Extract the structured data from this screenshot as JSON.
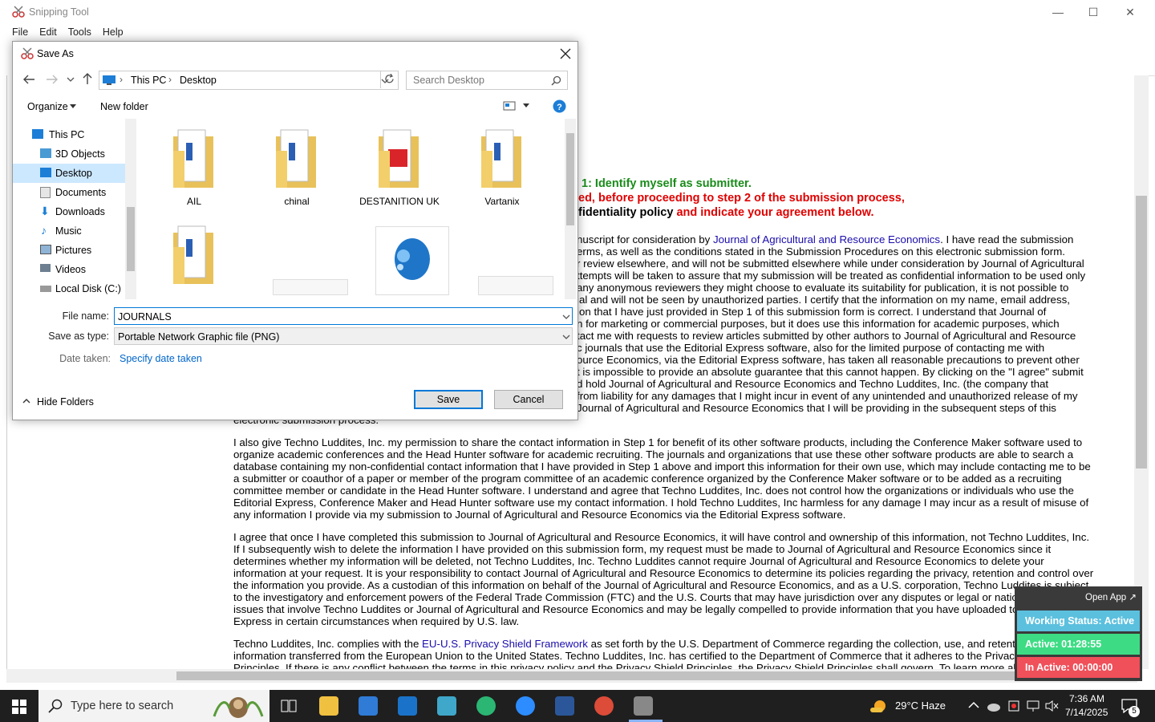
{
  "snip": {
    "title": "Snipping Tool",
    "menu": [
      "File",
      "Edit",
      "Tools",
      "Help"
    ],
    "controls": {
      "minimize": "—",
      "maximize": "☐",
      "close": "✕"
    }
  },
  "doc": {
    "step_heading": "1: Identify myself as submitter.",
    "warning_line1": "ed, before proceeding to step 2 of the submission process,",
    "warning_line2a": "fidentiality policy",
    "warning_line2b": " and indicate your agreement below.",
    "para1": [
      {
        "pre": "nuscript for consideration by ",
        "link": "Journal of Agricultural and Resource Economics",
        "post": ". I have read the submission"
      },
      {
        "text": "erms, as well as the conditions stated in the Submission Procedures on this electronic submission form."
      },
      {
        "text": "r review elsewhere, and will not be submitted elsewhere while under consideration by Journal of Agricultural"
      },
      {
        "text": "ttempts will be taken to assure that my submission will be treated as confidential information to be used only"
      },
      {
        "text": "any anonymous reviewers they might choose to evaluate its suitability for publication, it is not possible to"
      },
      {
        "text": "ial and will not be seen by unauthorized parties. I certify that the information on my name, email address,"
      },
      {
        "text": "ion that I have just provided in Step 1 of this submission form is correct. I understand that Journal of"
      },
      {
        "text": "n for marketing or commercial purposes, but it does use this information for academic purposes, which"
      },
      {
        "text": "tact me with requests to review articles submitted by other authors to Journal of Agricultural and Resource"
      },
      {
        "text": "c journals that use the Editorial Express software, also for the limited purpose of contacting me with"
      },
      {
        "text": "ource Economics, via the Editorial Express software, has taken all reasonable precautions to prevent other"
      },
      {
        "text": "t is impossible to provide an absolute guarantee that this cannot happen. By clicking on the \"I agree\" submit"
      },
      {
        "text": "d hold Journal of Agricultural and Resource Economics and Techno Luddites, Inc. (the company that"
      },
      {
        "text": "from liability for any damages that I might incur in event of any unintended and unauthorized release of my"
      },
      {
        "text": "Journal of Agricultural and Resource Economics that I will be providing in the subsequent steps of this"
      },
      {
        "text": "electronic submission process."
      }
    ],
    "para2": [
      "I also give Techno Luddites, Inc. my permission to share the contact information in Step 1 for benefit of its other software products, including the Conference Maker software used to",
      "organize academic conferences and the Head Hunter software for academic recruiting. The journals and organizations that use these other software products are able to search a",
      "database containing my non-confidential contact information that I have provided in Step 1 above and import this information for their own use, which may include contacting me to be",
      "a submitter or coauthor of a paper or member of the program committee of an academic conference organized by the Conference Maker software or to be added as a recruiting",
      "committee member or candidate in the Head Hunter software. I understand and agree that Techno Luddites, Inc. does not control how the organizations or individuals who use the",
      "Editorial Express, Conference Maker and Head Hunter software use my contact information. I hold Techno Luddites, Inc harmless for any damage I may incur as a result of misuse of",
      "any information I provide via my submission to Journal of Agricultural and Resource Economics via the Editorial Express software."
    ],
    "para3": [
      "I agree that once I have completed this submission to Journal of Agricultural and Resource Economics, it will have control and ownership of this information, not Techno Luddites, Inc.",
      "If I subsequently wish to delete the information I have provided on this submission form, my request must be made to Journal of Agricultural and Resource Economics since it",
      "determines whether my information will be deleted, not Techno Luddites, Inc. Techno Luddites cannot require Journal of Agricultural and Resource Economics to delete your",
      "information at your request. It is your responsibility to contact Journal of Agricultural and Resource Economics to determine its policies regarding the privacy, retention and control over",
      "the information you provide. As a custodian of this information on behalf of the Journal of Agricultural and Resource Economics, and as a U.S. corporation, Techno Luddites is subject",
      "to the investigatory and enforcement powers of the Federal Trade Commission (FTC) and the U.S. Courts that may have jurisdiction over any disputes or legal or national security",
      "issues that involve Techno Luddites or Journal of Agricultural and Resource Economics and may be legally compelled to provide information that you have uploaded to Editorial",
      "Express in certain circumstances when required by U.S. law."
    ],
    "para4_line1_pre": "Techno Luddites, Inc. complies with the ",
    "para4_line1_link": "EU-U.S. Privacy Shield Framework",
    "para4_line1_post": " as set forth by the U.S. Department of Commerce regarding the collection, use, and retention of",
    "para4_line2": "information transferred from the European Union to the United States. Techno Luddites, Inc. has certified to the Department of Commerce that it adheres to the Privacy Shield",
    "para4_line3": "Principles. If there is any conflict between the terms in this privacy policy and the Privacy Shield Principles, the Privacy Shield Principles shall govern. To learn more about the"
  },
  "dialog": {
    "title": "Save As",
    "path": [
      "This PC",
      "Desktop"
    ],
    "search_placeholder": "Search Desktop",
    "organize": "Organize",
    "new_folder": "New folder",
    "nav": [
      "This PC",
      "3D Objects",
      "Desktop",
      "Documents",
      "Downloads",
      "Music",
      "Pictures",
      "Videos",
      "Local Disk (C:)"
    ],
    "folders": [
      "AIL",
      "chinal",
      "DESTANITION UK",
      "Vartanix"
    ],
    "file_name_label": "File name:",
    "file_name_value": "JOURNALS",
    "save_type_label": "Save as type:",
    "save_type_value": "Portable Network Graphic file (PNG)",
    "date_label": "Date taken:",
    "date_link": "Specify date taken",
    "hide_folders": "Hide Folders",
    "save": "Save",
    "cancel": "Cancel"
  },
  "tracker": {
    "open_app": "Open App ↗",
    "status": "Working Status: Active",
    "active": "Active: 01:28:55",
    "inactive": "In Active: 00:00:00",
    "colors": {
      "status": "#5bc0de",
      "active": "#3ddc84",
      "inactive": "#f0505a"
    }
  },
  "taskbar": {
    "search_placeholder": "Type here to search",
    "weather": "29°C  Haze",
    "time": "7:36 AM",
    "date": "7/14/2025",
    "notif_count": "5"
  }
}
